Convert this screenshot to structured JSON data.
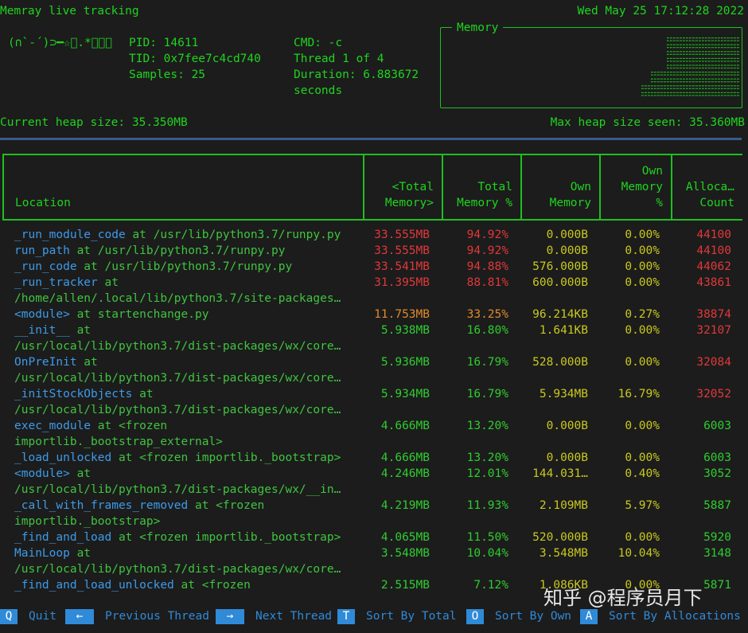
{
  "header": {
    "title": "Memray live tracking",
    "datetime": "Wed May 25 17:12:28 2022",
    "kaomoji": "(∩`-´)⊃━☆ﾟ.*･｡ﾟ",
    "pid": "PID: 14611",
    "tid": "TID: 0x7fee7c4cd740",
    "samples": "Samples: 25",
    "cmd": "CMD: -c",
    "thread": "Thread 1 of 4",
    "duration": "Duration: 6.883672",
    "duration_unit": "seconds",
    "memory_panel_title": "Memory"
  },
  "heap": {
    "current": "Current heap size: 35.350MB",
    "max": "Max heap size seen: 35.360MB"
  },
  "columns": [
    "Location",
    "<Total\nMemory>",
    "Total\nMemory %",
    "Own\nMemory",
    "Own\nMemory\n%",
    "Alloca…\nCount"
  ],
  "rows": [
    {
      "fn": "_run_module_code",
      "at": " at ",
      "path": "/usr/lib/python3.7/runpy.py",
      "wrap": "",
      "total": "33.555MB",
      "pct": "94.92%",
      "own": "0.000B",
      "opct": "0.00%",
      "count": "44100",
      "tc": "red",
      "cc": "red"
    },
    {
      "fn": "run_path",
      "at": " at ",
      "path": "/usr/lib/python3.7/runpy.py",
      "wrap": "",
      "total": "33.555MB",
      "pct": "94.92%",
      "own": "0.000B",
      "opct": "0.00%",
      "count": "44100",
      "tc": "red",
      "cc": "red"
    },
    {
      "fn": "_run_code",
      "at": " at ",
      "path": "/usr/lib/python3.7/runpy.py",
      "wrap": "",
      "total": "33.541MB",
      "pct": "94.88%",
      "own": "576.000B",
      "opct": "0.00%",
      "count": "44062",
      "tc": "red",
      "cc": "red"
    },
    {
      "fn": "_run_tracker",
      "at": " at",
      "path": "",
      "wrap": "/home/allen/.local/lib/python3.7/site-packages…",
      "total": "31.395MB",
      "pct": "88.81%",
      "own": "600.000B",
      "opct": "0.00%",
      "count": "43861",
      "tc": "red",
      "cc": "red"
    },
    {
      "fn": "<module>",
      "at": " at ",
      "path": "startenchange.py",
      "wrap": "",
      "total": "11.753MB",
      "pct": "33.25%",
      "own": "96.214KB",
      "opct": "0.27%",
      "count": "38874",
      "tc": "orange",
      "cc": "red"
    },
    {
      "fn": "__init__",
      "at": " at",
      "path": "",
      "wrap": "/usr/local/lib/python3.7/dist-packages/wx/core…",
      "total": "5.938MB",
      "pct": "16.80%",
      "own": "1.641KB",
      "opct": "0.00%",
      "count": "32107",
      "tc": "gr",
      "cc": "red"
    },
    {
      "fn": "OnPreInit",
      "at": " at",
      "path": "",
      "wrap": "/usr/local/lib/python3.7/dist-packages/wx/core…",
      "total": "5.936MB",
      "pct": "16.79%",
      "own": "528.000B",
      "opct": "0.00%",
      "count": "32084",
      "tc": "gr",
      "cc": "red"
    },
    {
      "fn": "_initStockObjects",
      "at": " at",
      "path": "",
      "wrap": "/usr/local/lib/python3.7/dist-packages/wx/core…",
      "total": "5.934MB",
      "pct": "16.79%",
      "own": "5.934MB",
      "opct": "16.79%",
      "count": "32052",
      "tc": "gr",
      "cc": "red"
    },
    {
      "fn": "exec_module",
      "at": " at ",
      "path": "<frozen",
      "wrap": "importlib._bootstrap_external>",
      "total": "4.666MB",
      "pct": "13.20%",
      "own": "0.000B",
      "opct": "0.00%",
      "count": "6003",
      "tc": "gr",
      "cc": "gr"
    },
    {
      "fn": "_load_unlocked",
      "at": " at ",
      "path": "<frozen importlib._bootstrap>",
      "wrap": "",
      "total": "4.666MB",
      "pct": "13.20%",
      "own": "0.000B",
      "opct": "0.00%",
      "count": "6003",
      "tc": "gr",
      "cc": "gr"
    },
    {
      "fn": "<module>",
      "at": " at",
      "path": "",
      "wrap": "/usr/local/lib/python3.7/dist-packages/wx/__in…",
      "total": "4.246MB",
      "pct": "12.01%",
      "own": "144.031…",
      "opct": "0.40%",
      "count": "3052",
      "tc": "gr",
      "cc": "gr"
    },
    {
      "fn": "_call_with_frames_removed",
      "at": " at ",
      "path": "<frozen",
      "wrap": "importlib._bootstrap>",
      "total": "4.219MB",
      "pct": "11.93%",
      "own": "2.109MB",
      "opct": "5.97%",
      "count": "5887",
      "tc": "gr",
      "cc": "gr"
    },
    {
      "fn": "_find_and_load",
      "at": " at ",
      "path": "<frozen importlib._bootstrap>",
      "wrap": "",
      "total": "4.065MB",
      "pct": "11.50%",
      "own": "520.000B",
      "opct": "0.00%",
      "count": "5920",
      "tc": "gr",
      "cc": "gr"
    },
    {
      "fn": "MainLoop",
      "at": " at",
      "path": "",
      "wrap": "/usr/local/lib/python3.7/dist-packages/wx/core…",
      "total": "3.548MB",
      "pct": "10.04%",
      "own": "3.548MB",
      "opct": "10.04%",
      "count": "3148",
      "tc": "gr",
      "cc": "gr"
    },
    {
      "fn": "_find_and_load_unlocked",
      "at": " at ",
      "path": "<frozen",
      "wrap": "",
      "total": "2.515MB",
      "pct": "7.12%",
      "own": "1.086KB",
      "opct": "0.00%",
      "count": "5871",
      "tc": "gr",
      "cc": "gr"
    }
  ],
  "footer": {
    "keys": [
      {
        "key": "Q",
        "label": "Quit"
      },
      {
        "key": "←",
        "label": "Previous Thread"
      },
      {
        "key": "→",
        "label": "Next Thread"
      },
      {
        "key": "T",
        "label": "Sort By Total"
      },
      {
        "key": "O",
        "label": "Sort By Own"
      },
      {
        "key": "A",
        "label": "Sort By Allocations"
      }
    ]
  },
  "watermark": "知乎 @程序员月下",
  "colors": {
    "background": "#1c1c1c",
    "green": "#1fd41f",
    "function_blue": "#3d9be9",
    "red": "#e0383a",
    "orange": "#e08a2a",
    "key_blue": "#2f8ad8",
    "divider": "#3a5a8a"
  }
}
